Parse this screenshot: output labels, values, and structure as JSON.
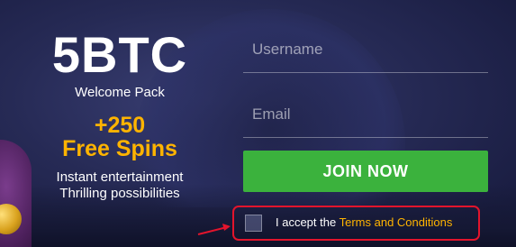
{
  "promo": {
    "amount": "5BTC",
    "pack_label": "Welcome Pack",
    "spins_count": "+250",
    "spins_label": "Free Spins",
    "line1": "Instant entertainment",
    "line2": "Thrilling possibilities"
  },
  "form": {
    "username_placeholder": "Username",
    "email_placeholder": "Email",
    "join_label": "JOIN NOW",
    "accept_text": "I accept the",
    "terms_link": "Terms and Conditions"
  },
  "colors": {
    "accent": "#ffb400",
    "button": "#3bb23d",
    "highlight": "#e3142c"
  },
  "icons": {
    "annotation": "arrow-icon"
  }
}
